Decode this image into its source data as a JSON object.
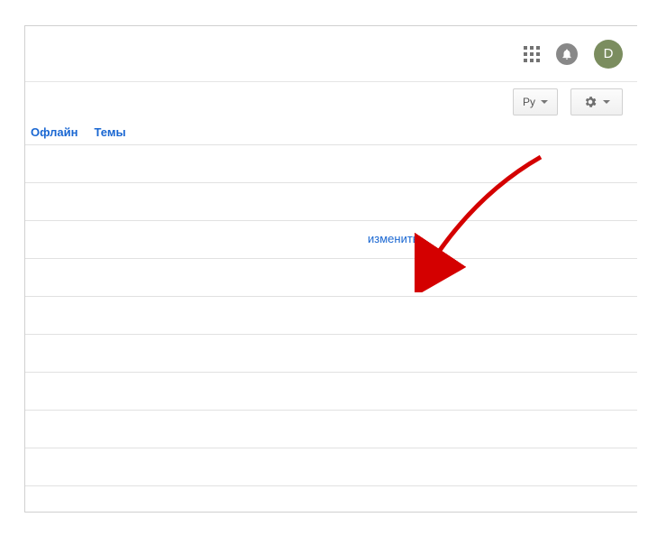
{
  "header": {
    "avatar_initial": "D"
  },
  "toolbar": {
    "lang_label": "Ру"
  },
  "tabs": {
    "offline_label": "Офлайн",
    "themes_label": "Темы"
  },
  "list": {
    "edit_label": "изменить"
  }
}
